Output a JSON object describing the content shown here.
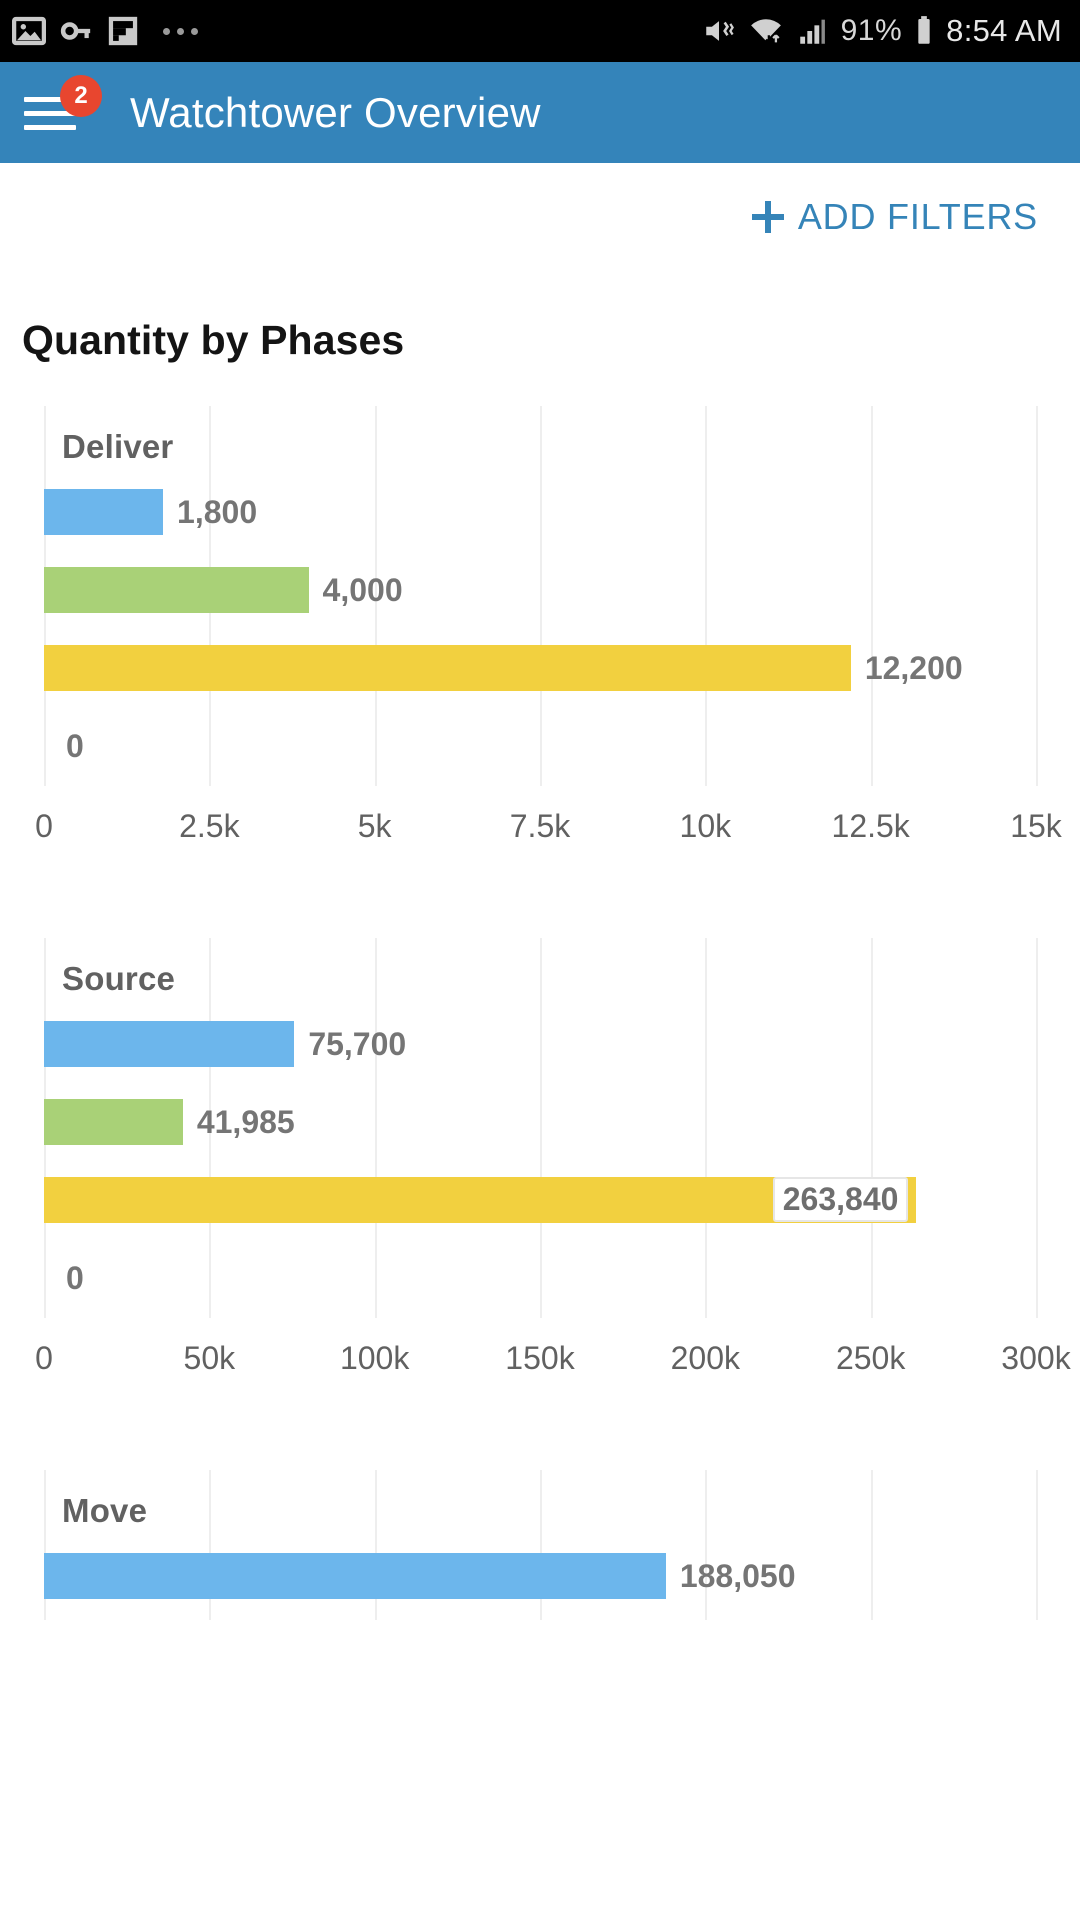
{
  "statusbar": {
    "icons_left": [
      "image-icon",
      "key-icon",
      "flipboard-icon",
      "overflow-dots-icon"
    ],
    "icons_right": [
      "mute-vibrate-icon",
      "wifi-icon",
      "signal-icon",
      "battery-icon"
    ],
    "battery_percent": "91%",
    "time": "8:54 AM"
  },
  "appbar": {
    "menu_icon": "hamburger-menu-icon",
    "badge_count": "2",
    "title": "Watchtower Overview",
    "background": "#3484ba"
  },
  "toolbar": {
    "add_filters_label": "ADD FILTERS",
    "add_filters_icon": "plus-icon",
    "accent_color": "#3584b8"
  },
  "main": {
    "page_title": "Quantity by Phases"
  },
  "colors": {
    "series_blue": "#6cb6ec",
    "series_green": "#a9d177",
    "series_yellow": "#f2d03f",
    "gridline": "#eeeeee",
    "label_gray": "#757575"
  },
  "chart_data": [
    {
      "type": "bar",
      "title": "Deliver",
      "orientation": "horizontal",
      "categories": [
        "Deliver"
      ],
      "values": [
        1800,
        4000,
        12200,
        0
      ],
      "value_labels": [
        "1,800",
        "4,000",
        "12,200",
        "0"
      ],
      "series_colors": [
        "#6cb6ec",
        "#a9d177",
        "#f2d03f",
        "none"
      ],
      "xlabel": "",
      "ylabel": "",
      "xlim": [
        0,
        15000
      ],
      "ticks": [
        "0",
        "2.5k",
        "5k",
        "7.5k",
        "10k",
        "12.5k",
        "15k"
      ],
      "tick_values": [
        0,
        2500,
        5000,
        7500,
        10000,
        12500,
        15000
      ],
      "grid": true,
      "legend": "none"
    },
    {
      "type": "bar",
      "title": "Source",
      "orientation": "horizontal",
      "categories": [
        "Source"
      ],
      "values": [
        75700,
        41985,
        263840,
        0
      ],
      "value_labels": [
        "75,700",
        "41,985",
        "263,840",
        "0"
      ],
      "series_colors": [
        "#6cb6ec",
        "#a9d177",
        "#f2d03f",
        "none"
      ],
      "label_inside_index": 2,
      "xlabel": "",
      "ylabel": "",
      "xlim": [
        0,
        300000
      ],
      "ticks": [
        "0",
        "50k",
        "100k",
        "150k",
        "200k",
        "250k",
        "300k"
      ],
      "tick_values": [
        0,
        50000,
        100000,
        150000,
        200000,
        250000,
        300000
      ],
      "grid": true,
      "legend": "none"
    },
    {
      "type": "bar",
      "title": "Move",
      "orientation": "horizontal",
      "categories": [
        "Move"
      ],
      "values": [
        188050
      ],
      "value_labels": [
        "188,050"
      ],
      "series_colors": [
        "#6cb6ec"
      ],
      "xlabel": "",
      "ylabel": "",
      "xlim": [
        0,
        300000
      ],
      "ticks": [],
      "tick_values": [],
      "grid": true,
      "legend": "none",
      "clipped": true
    }
  ]
}
